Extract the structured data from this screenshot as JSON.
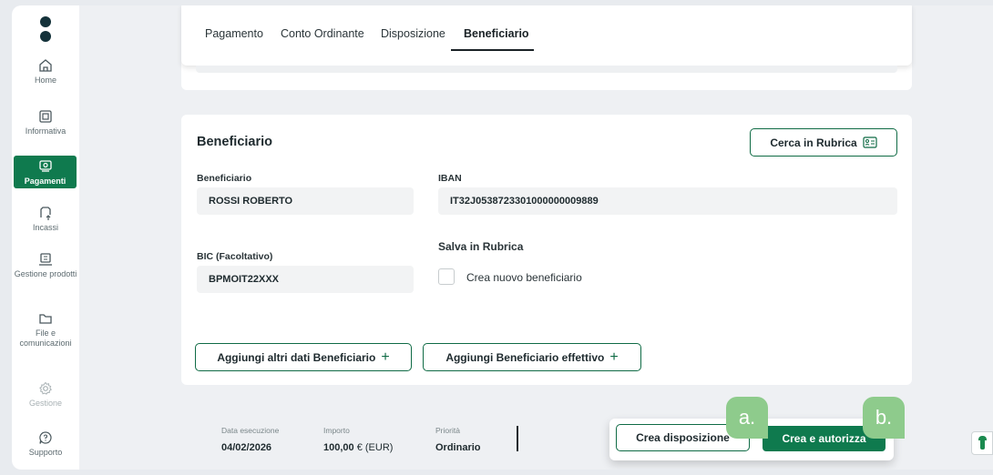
{
  "sidebar": {
    "items": [
      {
        "label": "Home",
        "icon": "home-icon"
      },
      {
        "label": "Informativa",
        "icon": "document-icon"
      },
      {
        "label": "Pagamenti",
        "icon": "payments-icon"
      },
      {
        "label": "Incassi",
        "icon": "collections-icon"
      },
      {
        "label": "Gestione prodotti",
        "icon": "products-icon"
      },
      {
        "label": "File e comunicazioni",
        "icon": "folder-icon"
      },
      {
        "label": "Gestione",
        "icon": "gear-icon"
      },
      {
        "label": "Supporto",
        "icon": "support-icon"
      }
    ]
  },
  "tabs": [
    {
      "label": "Pagamento"
    },
    {
      "label": "Conto Ordinante"
    },
    {
      "label": "Disposizione"
    },
    {
      "label": "Beneficiario"
    }
  ],
  "beneficiario": {
    "title": "Beneficiario",
    "search_button": "Cerca in Rubrica",
    "beneficiary_label": "Beneficiario",
    "beneficiary_value": "ROSSI ROBERTO",
    "iban_label": "IBAN",
    "iban_value": "IT32J0538723301000000009889",
    "bic_label": "BIC (Facoltativo)",
    "bic_value": "BPMOIT22XXX",
    "save_section_label": "Salva in Rubrica",
    "new_beneficiary_label": "Crea nuovo beneficiario",
    "add_more_button": "Aggiungi altri dati Beneficiario",
    "add_effective_button": "Aggiungi Beneficiario effettivo"
  },
  "footer": {
    "date_label": "Data esecuzione",
    "date_value": "04/02/2026",
    "amount_label": "Importo",
    "amount_value": "100,00",
    "amount_currency": "€ (EUR)",
    "priority_label": "Priorità",
    "priority_value": "Ordinario",
    "create_button": "Crea disposizione",
    "create_authorize_button": "Crea e autorizza"
  },
  "markers": {
    "a": "a.",
    "b": "b."
  },
  "colors": {
    "accent": "#0f7a4e",
    "marker": "#8ecb8c",
    "background": "#eef0f3"
  }
}
